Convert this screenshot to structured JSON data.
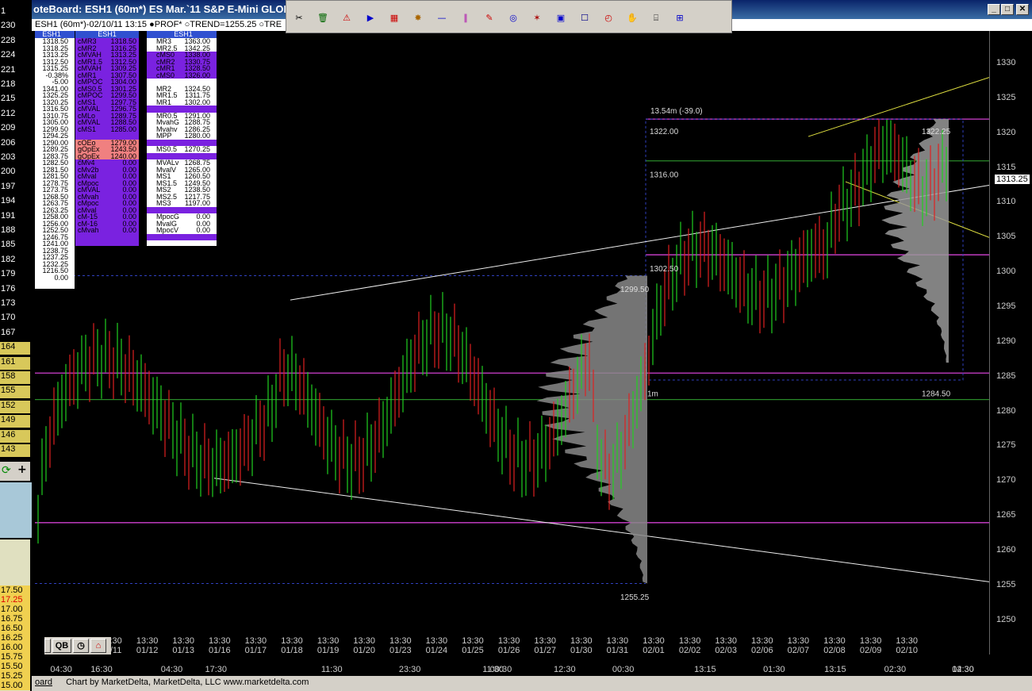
{
  "window": {
    "title": "oteBoard: ESH1 (60m*) ES Mar.`11 S&P E-Mini GLOBEX",
    "info": "ESH1 (60m*)-02/10/11 13:15  ●PROF*  ○TREND=1255.25  ○TRE",
    "min": "_",
    "max": "□",
    "close": "✕"
  },
  "left_numbers": [
    "1",
    "230",
    "228",
    "224",
    "221",
    "218",
    "215",
    "212",
    "209",
    "206",
    "203",
    "200",
    "197",
    "194",
    "191",
    "188",
    "185",
    "182",
    "179",
    "176",
    "173",
    "170",
    "167",
    "164",
    "161",
    "158",
    "155",
    "152",
    "149",
    "146",
    "143"
  ],
  "lower_left_numbers": [
    "17.50",
    "17.25",
    "17.00",
    "16.75",
    "16.50",
    "16.25",
    "16.00",
    "15.75",
    "15.50",
    "15.25",
    "15.00"
  ],
  "price_column": [
    "ESH1",
    "1318.50",
    "1318.25",
    "1313.25",
    "1312.50",
    "1315.25",
    "-0.38%",
    "-5.00",
    "1341.00",
    "1325.25",
    "1320.25",
    "1316.50",
    "1310.75",
    "1305.00",
    "1299.50",
    "1294.25",
    "1290.00",
    "1289.25",
    "1283.75",
    "1282.50",
    "1281.50",
    "1281.50",
    "1278.75",
    "1273.75",
    "1268.50",
    "1263.75",
    "1263.25",
    "1258.00",
    "1256.00",
    "1252.50",
    "1246.75",
    "1241.00",
    "1238.75",
    "1237.25",
    "1232.25",
    "1216.50",
    "0.00"
  ],
  "stat_column": [
    {
      "k": "ESH1",
      "v": ""
    },
    {
      "k": "cMR3",
      "v": "1318.50"
    },
    {
      "k": "cMR2",
      "v": "1316.25"
    },
    {
      "k": "cMVAH",
      "v": "1313.25"
    },
    {
      "k": "cMR1.5",
      "v": "1312.50"
    },
    {
      "k": "cMVAH",
      "v": "1309.25"
    },
    {
      "k": "cMR1",
      "v": "1307.50"
    },
    {
      "k": "cMPOC",
      "v": "1304.00"
    },
    {
      "k": "cMS0.5",
      "v": "1301.25"
    },
    {
      "k": "cMPOC",
      "v": "1299.50"
    },
    {
      "k": "cMS1",
      "v": "1297.75"
    },
    {
      "k": "cMVAL",
      "v": "1296.75"
    },
    {
      "k": "cMLo",
      "v": "1289.75"
    },
    {
      "k": "cMVAL",
      "v": "1288.50"
    },
    {
      "k": "cMS1",
      "v": "1285.00"
    },
    {
      "k": "",
      "v": ""
    },
    {
      "k": "cOEo",
      "v": "1279.00",
      "s": 1
    },
    {
      "k": "gOpEx",
      "v": "1243.50",
      "s": 1
    },
    {
      "k": "gOpEx",
      "v": "1240.00",
      "s": 1
    },
    {
      "k": "cMv4",
      "v": "0.00"
    },
    {
      "k": "cMv2b",
      "v": "0.00"
    },
    {
      "k": "cMval",
      "v": "0.00"
    },
    {
      "k": "cMpoc",
      "v": "0.00"
    },
    {
      "k": "cMVAL",
      "v": "0.00"
    },
    {
      "k": "cMvah",
      "v": "0.00"
    },
    {
      "k": "cMpoc",
      "v": "0.00"
    },
    {
      "k": "cMval",
      "v": "0.00"
    },
    {
      "k": "cM-15",
      "v": "0.00"
    },
    {
      "k": "cM-16",
      "v": "0.00"
    },
    {
      "k": "cMvah",
      "v": "0.00"
    }
  ],
  "mr_column": [
    {
      "k": "ESH1",
      "v": ""
    },
    {
      "k": "MR3",
      "v": "1363.00"
    },
    {
      "k": "MR2.5",
      "v": "1342.25"
    },
    {
      "k": "cMS0",
      "v": "1338.00",
      "b": 1
    },
    {
      "k": "cMR2",
      "v": "1330.75",
      "b": 1
    },
    {
      "k": "cMR1",
      "v": "1328.50",
      "b": 1
    },
    {
      "k": "cMS0",
      "v": "1326.00",
      "b": 1
    },
    {
      "k": "",
      "v": ""
    },
    {
      "k": "MR2",
      "v": "1324.50"
    },
    {
      "k": "MR1.5",
      "v": "1311.75"
    },
    {
      "k": "MR1",
      "v": "1302.00"
    },
    {
      "k": "",
      "v": "",
      "b": 1
    },
    {
      "k": "MR0.5",
      "v": "1291.00"
    },
    {
      "k": "MvahG",
      "v": "1288.75"
    },
    {
      "k": "Mvahv",
      "v": "1286.25"
    },
    {
      "k": "MPP",
      "v": "1280.00"
    },
    {
      "k": "",
      "v": "",
      "b": 1
    },
    {
      "k": "MS0.5",
      "v": "1270.25"
    },
    {
      "k": "",
      "v": "",
      "b": 1
    },
    {
      "k": "MVALv",
      "v": "1268.75"
    },
    {
      "k": "MvalV",
      "v": "1265.00"
    },
    {
      "k": "MS1",
      "v": "1260.50"
    },
    {
      "k": "MS1.5",
      "v": "1249.50"
    },
    {
      "k": "MS2",
      "v": "1238.50"
    },
    {
      "k": "MS2.5",
      "v": "1217.75"
    },
    {
      "k": "MS3",
      "v": "1197.00"
    },
    {
      "k": "",
      "v": "",
      "b": 1
    },
    {
      "k": "MpocG",
      "v": "0.00"
    },
    {
      "k": "MvalG",
      "v": "0.00"
    },
    {
      "k": "MpocV",
      "v": "0.00"
    },
    {
      "k": "",
      "v": "",
      "b": 1
    }
  ],
  "chart_data": {
    "type": "bar",
    "y_ticks": [
      1330,
      1325,
      1320,
      1315,
      1310,
      1305,
      1300,
      1295,
      1290,
      1285,
      1280,
      1275,
      1270,
      1265,
      1260,
      1255,
      1250
    ],
    "current_price": "1313.25",
    "price_labels": [
      {
        "t": "13.54m (-39.0)"
      },
      {
        "t": "1322.00"
      },
      {
        "t": "1316.00"
      },
      {
        "t": "1322.25"
      },
      {
        "t": "1302.50"
      },
      {
        "t": "1299.50"
      },
      {
        "t": "1284.50"
      },
      {
        "t": "1m"
      },
      {
        "t": "1255.25"
      }
    ],
    "time_labels": [
      {
        "a": "13:30",
        "b": "01/11"
      },
      {
        "a": "13:30",
        "b": "01/12"
      },
      {
        "a": "13:30",
        "b": "01/13"
      },
      {
        "a": "13:30",
        "b": "01/16"
      },
      {
        "a": "13:30",
        "b": "01/17"
      },
      {
        "a": "13:30",
        "b": "01/18"
      },
      {
        "a": "13:30",
        "b": "01/19"
      },
      {
        "a": "13:30",
        "b": "01/20"
      },
      {
        "a": "13:30",
        "b": "01/23"
      },
      {
        "a": "13:30",
        "b": "01/24"
      },
      {
        "a": "13:30",
        "b": "01/25"
      },
      {
        "a": "13:30",
        "b": "01/26"
      },
      {
        "a": "13:30",
        "b": "01/27"
      },
      {
        "a": "13:30",
        "b": "01/30"
      },
      {
        "a": "13:30",
        "b": "01/31"
      },
      {
        "a": "13:30",
        "b": "02/01"
      },
      {
        "a": "13:30",
        "b": "02/02"
      },
      {
        "a": "13:30",
        "b": "02/03"
      },
      {
        "a": "13:30",
        "b": "02/06"
      },
      {
        "a": "13:30",
        "b": "02/07"
      },
      {
        "a": "13:30",
        "b": "02/08"
      },
      {
        "a": "13:30",
        "b": "02/09"
      },
      {
        "a": "13:30",
        "b": "02/10"
      }
    ],
    "sub_time_labels": [
      "04:30",
      "16:30",
      "04:30",
      "17:30",
      "11:30",
      "23:30",
      "11:30",
      "00:30",
      "12:30",
      "00:30",
      "13:15",
      "01:30",
      "13:15",
      "02:30",
      "14:30",
      "02:30"
    ]
  },
  "status": {
    "left": "oard",
    "text": "Chart by MarketDelta, MarketDelta, LLC www.marketdelta.com"
  },
  "buttons": {
    "qb": "QB"
  }
}
